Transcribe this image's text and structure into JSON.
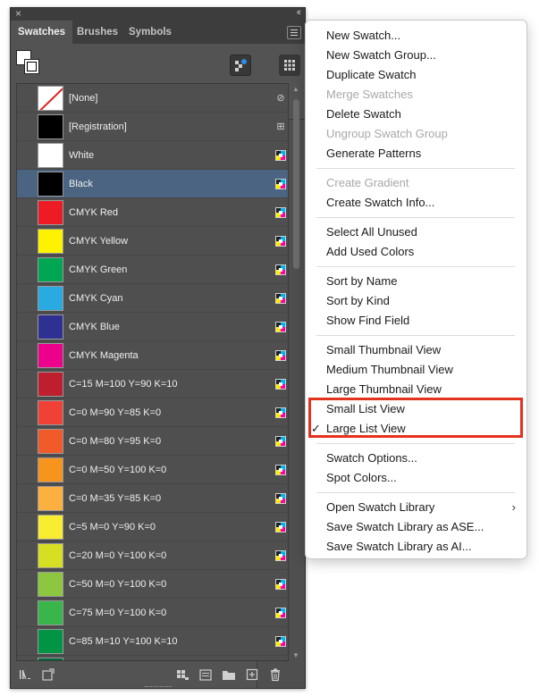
{
  "panel": {
    "tabs": [
      "Swatches",
      "Brushes",
      "Symbols"
    ],
    "active_tab": "Swatches",
    "title_close": "×",
    "title_collapse": "‹‹"
  },
  "swatches": [
    {
      "name": "[None]",
      "color": "none",
      "icon": "none-swatch-icon"
    },
    {
      "name": "[Registration]",
      "color": "#000000",
      "icon": "registration-icon"
    },
    {
      "name": "White",
      "color": "#ffffff",
      "icon": "cmyk-process-icon"
    },
    {
      "name": "Black",
      "color": "#000000",
      "icon": "cmyk-process-icon",
      "selected": true
    },
    {
      "name": "CMYK Red",
      "color": "#ed1c24",
      "icon": "cmyk-process-icon"
    },
    {
      "name": "CMYK Yellow",
      "color": "#fff200",
      "icon": "cmyk-process-icon"
    },
    {
      "name": "CMYK Green",
      "color": "#00a651",
      "icon": "cmyk-process-icon"
    },
    {
      "name": "CMYK Cyan",
      "color": "#29abe2",
      "icon": "cmyk-process-icon"
    },
    {
      "name": "CMYK Blue",
      "color": "#2e3192",
      "icon": "cmyk-process-icon"
    },
    {
      "name": "CMYK Magenta",
      "color": "#ec008c",
      "icon": "cmyk-process-icon"
    },
    {
      "name": "C=15 M=100 Y=90 K=10",
      "color": "#be1e2d",
      "icon": "cmyk-process-icon"
    },
    {
      "name": "C=0 M=90 Y=85 K=0",
      "color": "#ef4136",
      "icon": "cmyk-process-icon"
    },
    {
      "name": "C=0 M=80 Y=95 K=0",
      "color": "#f15a29",
      "icon": "cmyk-process-icon"
    },
    {
      "name": "C=0 M=50 Y=100 K=0",
      "color": "#f7941d",
      "icon": "cmyk-process-icon"
    },
    {
      "name": "C=0 M=35 Y=85 K=0",
      "color": "#fbb040",
      "icon": "cmyk-process-icon"
    },
    {
      "name": "C=5 M=0 Y=90 K=0",
      "color": "#f9ed32",
      "icon": "cmyk-process-icon"
    },
    {
      "name": "C=20 M=0 Y=100 K=0",
      "color": "#d7df23",
      "icon": "cmyk-process-icon"
    },
    {
      "name": "C=50 M=0 Y=100 K=0",
      "color": "#8dc63f",
      "icon": "cmyk-process-icon"
    },
    {
      "name": "C=75 M=0 Y=100 K=0",
      "color": "#39b54a",
      "icon": "cmyk-process-icon"
    },
    {
      "name": "C=85 M=10 Y=100 K=10",
      "color": "#009444",
      "icon": "cmyk-process-icon"
    },
    {
      "name": "",
      "color": "#006838",
      "icon": "cmyk-process-icon"
    }
  ],
  "menu": {
    "groups": [
      [
        {
          "label": "New Swatch..."
        },
        {
          "label": "New Swatch Group..."
        },
        {
          "label": "Duplicate Swatch"
        },
        {
          "label": "Merge Swatches",
          "disabled": true
        },
        {
          "label": "Delete Swatch"
        },
        {
          "label": "Ungroup Swatch Group",
          "disabled": true
        },
        {
          "label": "Generate Patterns"
        }
      ],
      [
        {
          "label": "Create Gradient",
          "disabled": true
        },
        {
          "label": "Create Swatch Info..."
        }
      ],
      [
        {
          "label": "Select All Unused"
        },
        {
          "label": "Add Used Colors"
        }
      ],
      [
        {
          "label": "Sort by Name"
        },
        {
          "label": "Sort by Kind"
        },
        {
          "label": "Show Find Field"
        }
      ],
      [
        {
          "label": "Small Thumbnail View"
        },
        {
          "label": "Medium Thumbnail View"
        },
        {
          "label": "Large Thumbnail View"
        },
        {
          "label": "Small List View"
        },
        {
          "label": "Large List View",
          "checked": true
        }
      ],
      [
        {
          "label": "Swatch Options..."
        },
        {
          "label": "Spot Colors..."
        }
      ],
      [
        {
          "label": "Open Swatch Library",
          "submenu": true
        },
        {
          "label": "Save Swatch Library as ASE..."
        },
        {
          "label": "Save Swatch Library as AI..."
        }
      ]
    ],
    "check_glyph": "✓",
    "submenu_glyph": "›"
  },
  "highlight_color": "#e5321e"
}
